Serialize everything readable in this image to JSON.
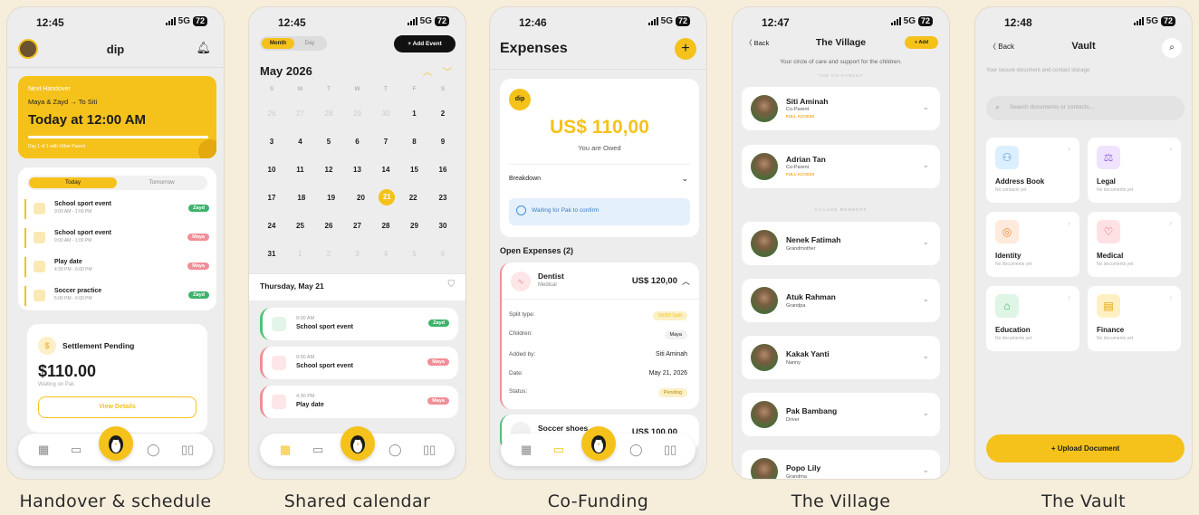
{
  "captions": [
    "Handover & schedule",
    "Shared calendar",
    "Co-Funding",
    "The Village",
    "The Vault"
  ],
  "screen1": {
    "time": "12:45",
    "network": "5G",
    "battery": "72",
    "title": "dip",
    "handover": {
      "label": "Next Handover",
      "route": "Maya & Zayd → To Siti",
      "when": "Today at 12:00 AM",
      "progress": "Day 1 of 1 with Other Parent"
    },
    "tabs": [
      "Today",
      "Tomorrow"
    ],
    "events": [
      {
        "title": "School sport event",
        "time": "9:00 AM - 1:00 PM",
        "tag": "Zayd"
      },
      {
        "title": "School sport event",
        "time": "9:00 AM - 1:00 PM",
        "tag": "Maya"
      },
      {
        "title": "Play date",
        "time": "4:30 PM - 6:00 PM",
        "tag": "Maya"
      },
      {
        "title": "Soccer practice",
        "time": "5:00 PM - 6:00 PM",
        "tag": "Zayd"
      }
    ],
    "settlement": {
      "title": "Settlement Pending",
      "amount": "$110.00",
      "sub": "Waiting on Pak",
      "button": "View Details",
      "icon": "$"
    }
  },
  "screen2": {
    "time": "12:45",
    "network": "5G",
    "battery": "72",
    "toggle": [
      "Month",
      "Day"
    ],
    "add": "+ Add Event",
    "month": "May 2026",
    "weekdays": [
      "S",
      "M",
      "T",
      "W",
      "T",
      "F",
      "S"
    ],
    "weeks": [
      [
        "26",
        "27",
        "28",
        "29",
        "30",
        "1",
        "2"
      ],
      [
        "3",
        "4",
        "5",
        "6",
        "7",
        "8",
        "9"
      ],
      [
        "10",
        "11",
        "12",
        "13",
        "14",
        "15",
        "16"
      ],
      [
        "17",
        "18",
        "19",
        "20",
        "21",
        "22",
        "23"
      ],
      [
        "24",
        "25",
        "26",
        "27",
        "28",
        "29",
        "30"
      ],
      [
        "31",
        "1",
        "2",
        "3",
        "4",
        "5",
        "6"
      ]
    ],
    "selected_day": "21",
    "day_title": "Thursday, May 21",
    "events": [
      {
        "time": "9:00 AM",
        "title": "School sport event",
        "tag": "Zayd"
      },
      {
        "time": "9:00 AM",
        "title": "School sport event",
        "tag": "Maya"
      },
      {
        "time": "4:30 PM",
        "title": "Play date",
        "tag": "Maya"
      }
    ]
  },
  "screen3": {
    "time": "12:46",
    "network": "5G",
    "battery": "72",
    "title": "Expenses",
    "badge": "dip",
    "amount": "US$ 110,00",
    "owed": "You are Owed",
    "breakdown": "Breakdown",
    "waiting": "Waiting for Pak to confirm",
    "open": "Open Expenses (2)",
    "expense": {
      "name": "Dentist",
      "cat": "Medical",
      "amount": "US$ 120,00",
      "rows": [
        {
          "k": "Split type:",
          "v": "50/50 Split"
        },
        {
          "k": "Children:",
          "v": "Maya"
        },
        {
          "k": "Added by:",
          "v": "Siti Aminah"
        },
        {
          "k": "Date:",
          "v": "May 21, 2026"
        },
        {
          "k": "Status:",
          "v": "Pending"
        }
      ]
    },
    "expense2": {
      "name": "Soccer shoes",
      "amount": "US$ 100,00"
    }
  },
  "screen4": {
    "time": "12:47",
    "network": "5G",
    "battery": "72",
    "back": "Back",
    "title": "The Village",
    "add": "+ Add",
    "subtitle": "Your circle of care and support for the children.",
    "sec1": "THE CO-PARENT",
    "sec2": "VILLAGE MEMBERS",
    "coparents": [
      {
        "name": "Siti Aminah",
        "role": "Co-Parent",
        "access": "FULL ACCESS"
      },
      {
        "name": "Adrian Tan",
        "role": "Co-Parent",
        "access": "FULL ACCESS"
      }
    ],
    "members": [
      {
        "name": "Nenek Fatimah",
        "role": "Grandmother"
      },
      {
        "name": "Atuk Rahman",
        "role": "Grandpa"
      },
      {
        "name": "Kakak Yanti",
        "role": "Nanny"
      },
      {
        "name": "Pak Bambang",
        "role": "Driver"
      },
      {
        "name": "Popo Lily",
        "role": "Grandma"
      }
    ]
  },
  "screen5": {
    "time": "12:48",
    "network": "5G",
    "battery": "72",
    "back": "Back",
    "title": "Vault",
    "subtitle": "Your secure document and contact storage",
    "search_placeholder": "Search documents or contacts...",
    "tiles": [
      {
        "name": "Address Book",
        "sub": "No contacts yet",
        "icon": "people-icon",
        "color": "#dcefff"
      },
      {
        "name": "Legal",
        "sub": "No documents yet",
        "icon": "scale-icon",
        "color": "#efe3ff"
      },
      {
        "name": "Identity",
        "sub": "No documents yet",
        "icon": "fingerprint-icon",
        "color": "#ffeadb"
      },
      {
        "name": "Medical",
        "sub": "No documents yet",
        "icon": "heart-icon",
        "color": "#ffe1e4"
      },
      {
        "name": "Education",
        "sub": "No documents yet",
        "icon": "graduation-icon",
        "color": "#dff5e6"
      },
      {
        "name": "Finance",
        "sub": "No documents yet",
        "icon": "finance-icon",
        "color": "#fff0c4"
      }
    ],
    "upload": "+ Upload Document"
  }
}
